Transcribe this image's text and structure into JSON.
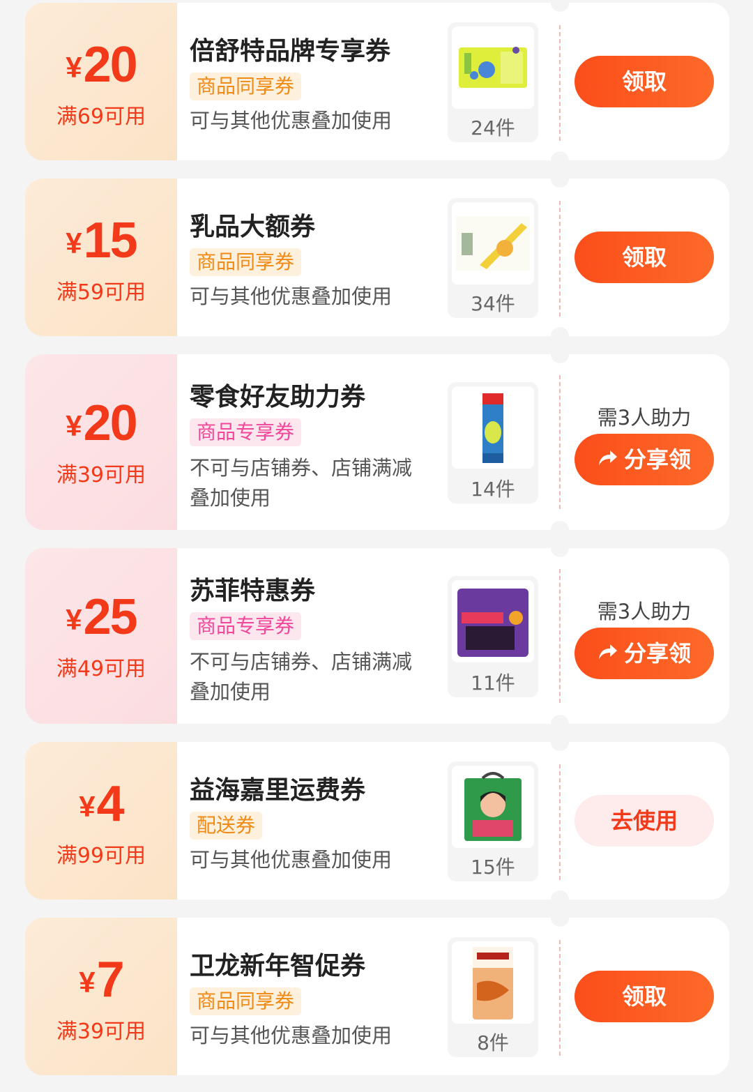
{
  "coupons": [
    {
      "currency": "¥",
      "amount": "20",
      "condition": "满69可用",
      "title": "倍舒特品牌专享券",
      "tag": "商品同享券",
      "description": "可与其他优惠叠加使用",
      "product_count": "24件",
      "action": "领取",
      "help_text": ""
    },
    {
      "currency": "¥",
      "amount": "15",
      "condition": "满59可用",
      "title": "乳品大额券",
      "tag": "商品同享券",
      "description": "可与其他优惠叠加使用",
      "product_count": "34件",
      "action": "领取",
      "help_text": ""
    },
    {
      "currency": "¥",
      "amount": "20",
      "condition": "满39可用",
      "title": "零食好友助力券",
      "tag": "商品专享券",
      "description_line1": "不可与店铺券、店铺满减",
      "description_line2": "叠加使用",
      "product_count": "14件",
      "action": "分享领",
      "help_text": "需3人助力"
    },
    {
      "currency": "¥",
      "amount": "25",
      "condition": "满49可用",
      "title": "苏菲特惠券",
      "tag": "商品专享券",
      "description_line1": "不可与店铺券、店铺满减",
      "description_line2": "叠加使用",
      "product_count": "11件",
      "action": "分享领",
      "help_text": "需3人助力"
    },
    {
      "currency": "¥",
      "amount": "4",
      "condition": "满99可用",
      "title": "益海嘉里运费券",
      "tag": "配送券",
      "description": "可与其他优惠叠加使用",
      "product_count": "15件",
      "action": "去使用",
      "help_text": ""
    },
    {
      "currency": "¥",
      "amount": "7",
      "condition": "满39可用",
      "title": "卫龙新年智促券",
      "tag": "商品同享券",
      "description": "可与其他优惠叠加使用",
      "product_count": "8件",
      "action": "领取",
      "help_text": ""
    }
  ],
  "colors": {
    "accent": "#f23a1b",
    "button_gradient_start": "#fb4e1a",
    "tag_shared_bg": "#fdf0dc",
    "tag_exclusive_bg": "#fde7ef",
    "left_orange_bg": "#fdebd8",
    "left_pink_bg": "#fde6e8"
  },
  "icons": {
    "share": "share-arrow-icon"
  }
}
